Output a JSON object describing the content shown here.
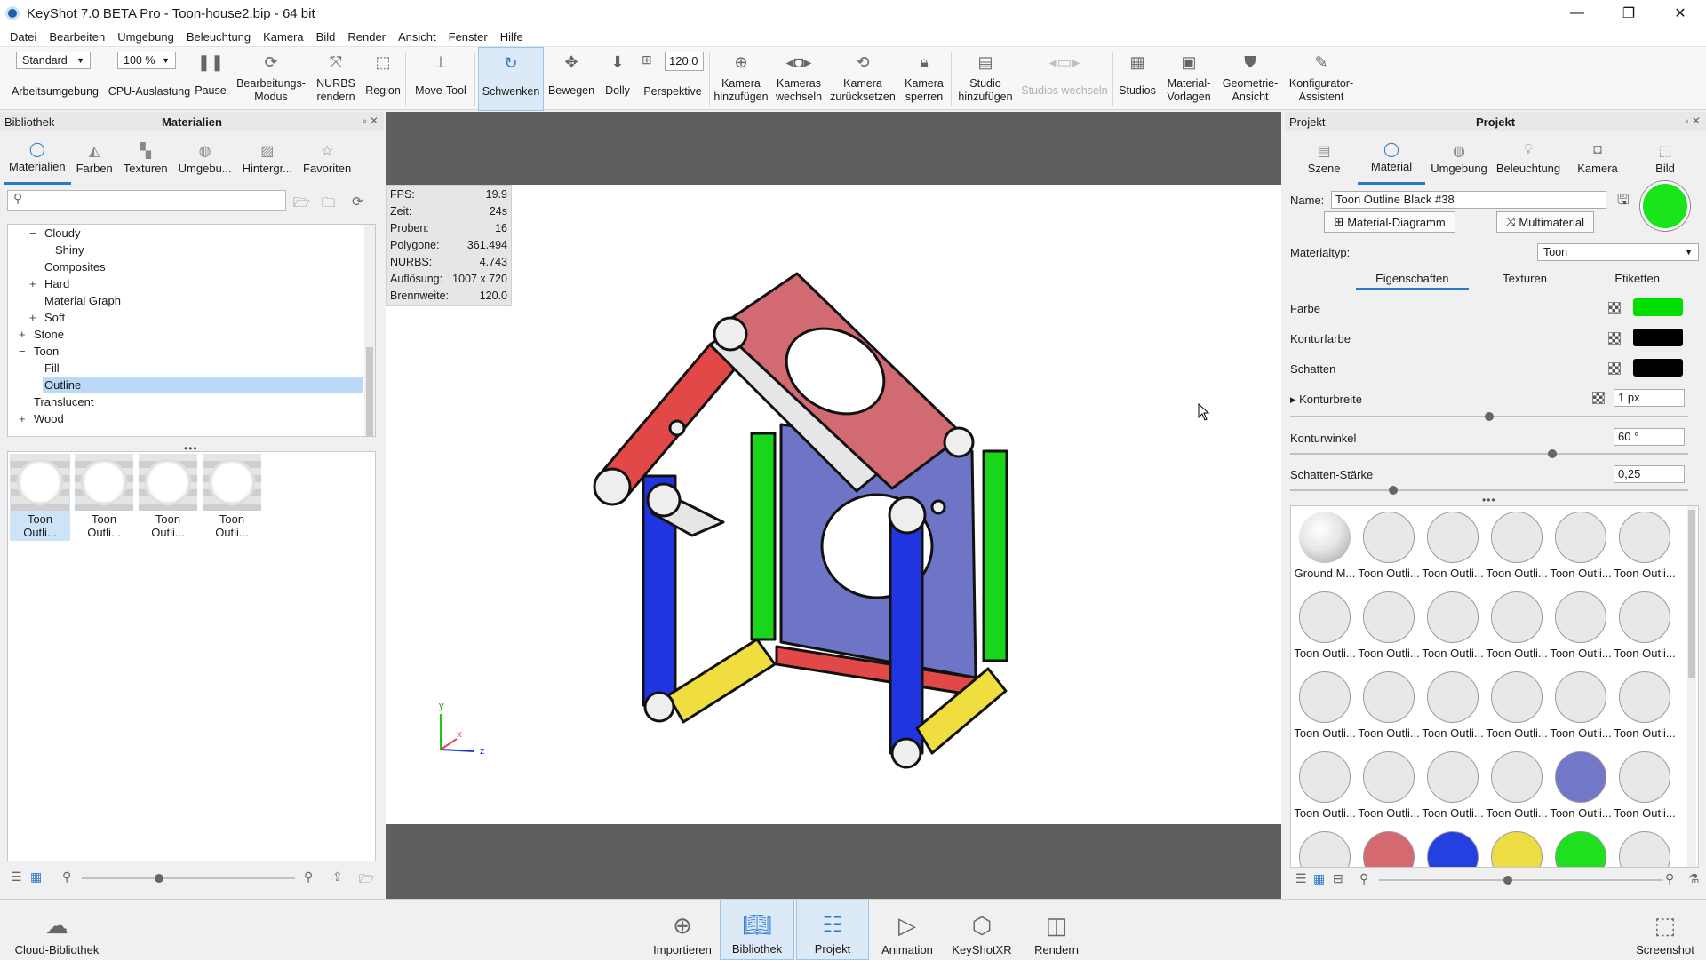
{
  "window": {
    "title": "KeyShot 7.0 BETA Pro  - Toon-house2.bip  - 64 bit",
    "minimize": "—",
    "maximize": "❐",
    "close": "✕"
  },
  "menu": [
    "Datei",
    "Bearbeiten",
    "Umgebung",
    "Beleuchtung",
    "Kamera",
    "Bild",
    "Render",
    "Ansicht",
    "Fenster",
    "Hilfe"
  ],
  "toolbar": {
    "workspace_value": "Standard",
    "cpu_value": "100 %",
    "focal_value": "120,0",
    "items": {
      "arbeitsumgebung": "Arbeitsumgebung",
      "cpu": "CPU-Auslastung",
      "pause": "Pause",
      "bearbeitungs": "Bearbeitungs-\nModus",
      "nurbs": "NURBS\nrendern",
      "region": "Region",
      "movetool": "Move-Tool",
      "schwenken": "Schwenken",
      "bewegen": "Bewegen",
      "dolly": "Dolly",
      "perspektive": "Perspektive",
      "kamera_hinzu": "Kamera\nhinzufügen",
      "kameras_wechseln": "Kameras\nwechseln",
      "kamera_zurueck": "Kamera\nzurücksetzen",
      "kamera_sperren": "Kamera\nsperren",
      "studio_hinzu": "Studio\nhinzufügen",
      "studios_wechseln": "Studios wechseln",
      "studios": "Studios",
      "material_vorlagen": "Material-\nVorlagen",
      "geometrie_ansicht": "Geometrie-\nAnsicht",
      "konfigurator": "Konfigurator-\nAssistent"
    }
  },
  "library": {
    "header_left": "Bibliothek",
    "header_center": "Materialien",
    "tabs": [
      "Materialien",
      "Farben",
      "Texturen",
      "Umgebu...",
      "Hintergr...",
      "Favoriten"
    ],
    "search_placeholder": "",
    "tree": [
      {
        "label": "Cloudy",
        "indent": 1,
        "exp": "−"
      },
      {
        "label": "Shiny",
        "indent": 2,
        "exp": ""
      },
      {
        "label": "Composites",
        "indent": 1,
        "exp": ""
      },
      {
        "label": "Hard",
        "indent": 1,
        "exp": "+"
      },
      {
        "label": "Material Graph",
        "indent": 1,
        "exp": ""
      },
      {
        "label": "Soft",
        "indent": 1,
        "exp": "+"
      },
      {
        "label": "Stone",
        "indent": 0,
        "exp": "+"
      },
      {
        "label": "Toon",
        "indent": 0,
        "exp": "−"
      },
      {
        "label": "Fill",
        "indent": 1,
        "exp": ""
      },
      {
        "label": "Outline",
        "indent": 1,
        "exp": "",
        "selected": true
      },
      {
        "label": "Translucent",
        "indent": 0,
        "exp": ""
      },
      {
        "label": "Wood",
        "indent": 0,
        "exp": "+"
      }
    ],
    "thumbnails": [
      "Toon Outli...",
      "Toon Outli...",
      "Toon Outli...",
      "Toon Outli..."
    ]
  },
  "stats": {
    "rows": [
      {
        "k": "FPS:",
        "v": "19.9"
      },
      {
        "k": "Zeit:",
        "v": "24s"
      },
      {
        "k": "Proben:",
        "v": "16"
      },
      {
        "k": "Polygone:",
        "v": "361.494"
      },
      {
        "k": "NURBS:",
        "v": "4.743"
      },
      {
        "k": "Auflösung:",
        "v": "1007 x 720"
      },
      {
        "k": "Brennweite:",
        "v": "120.0"
      }
    ]
  },
  "axes": {
    "y": "y",
    "x": "x",
    "z": "z"
  },
  "project": {
    "header_left": "Projekt",
    "header_center": "Projekt",
    "tabs": [
      "Szene",
      "Material",
      "Umgebung",
      "Beleuchtung",
      "Kamera",
      "Bild"
    ],
    "name_label": "Name:",
    "name_value": "Toon Outline Black #38",
    "btn_graph": "Material-Diagramm",
    "btn_multi": "Multimaterial",
    "type_label": "Materialtyp:",
    "type_value": "Toon",
    "subtabs": [
      "Eigenschaften",
      "Texturen",
      "Etiketten"
    ],
    "props": {
      "farbe": "Farbe",
      "konturfarbe": "Konturfarbe",
      "schatten": "Schatten",
      "konturbreite": "Konturbreite",
      "konturbreite_val": "1 px",
      "konturwinkel": "Konturwinkel",
      "konturwinkel_val": "60 °",
      "schattenstaerke": "Schatten-Stärke",
      "schattenstaerke_val": "0,25"
    },
    "colors": {
      "farbe": "#00e000",
      "kontur": "#000000",
      "schatten": "#000000",
      "preview": "#19e619"
    },
    "grid": [
      {
        "name": "Ground M...",
        "color": "sphere"
      },
      {
        "name": "Toon Outli...",
        "color": "#e8e8e8"
      },
      {
        "name": "Toon Outli...",
        "color": "#e8e8e8"
      },
      {
        "name": "Toon Outli...",
        "color": "#e8e8e8"
      },
      {
        "name": "Toon Outli...",
        "color": "#e8e8e8"
      },
      {
        "name": "Toon Outli...",
        "color": "#e8e8e8"
      },
      {
        "name": "Toon Outli...",
        "color": "#e8e8e8"
      },
      {
        "name": "Toon Outli...",
        "color": "#e8e8e8"
      },
      {
        "name": "Toon Outli...",
        "color": "#e8e8e8"
      },
      {
        "name": "Toon Outli...",
        "color": "#e8e8e8"
      },
      {
        "name": "Toon Outli...",
        "color": "#e8e8e8"
      },
      {
        "name": "Toon Outli...",
        "color": "#e8e8e8"
      },
      {
        "name": "Toon Outli...",
        "color": "#e8e8e8"
      },
      {
        "name": "Toon Outli...",
        "color": "#e8e8e8"
      },
      {
        "name": "Toon Outli...",
        "color": "#e8e8e8"
      },
      {
        "name": "Toon Outli...",
        "color": "#e8e8e8"
      },
      {
        "name": "Toon Outli...",
        "color": "#e8e8e8"
      },
      {
        "name": "Toon Outli...",
        "color": "#e8e8e8"
      },
      {
        "name": "Toon Outli...",
        "color": "#e8e8e8"
      },
      {
        "name": "Toon Outli...",
        "color": "#e8e8e8"
      },
      {
        "name": "Toon Outli...",
        "color": "#e8e8e8"
      },
      {
        "name": "Toon Outli...",
        "color": "#e8e8e8"
      },
      {
        "name": "Toon Outli...",
        "color": "#7277c7"
      },
      {
        "name": "Toon Outli...",
        "color": "#e8e8e8"
      },
      {
        "name": "",
        "color": "#e8e8e8"
      },
      {
        "name": "",
        "color": "#d46a70"
      },
      {
        "name": "",
        "color": "#2540e0"
      },
      {
        "name": "",
        "color": "#eedc45"
      },
      {
        "name": "",
        "color": "#1ee01e"
      },
      {
        "name": "",
        "color": "#e8e8e8"
      }
    ]
  },
  "bottom": {
    "cloud": "Cloud-Bibliothek",
    "items": [
      "Importieren",
      "Bibliothek",
      "Projekt",
      "Animation",
      "KeyShotXR",
      "Rendern"
    ],
    "screenshot": "Screenshot"
  }
}
